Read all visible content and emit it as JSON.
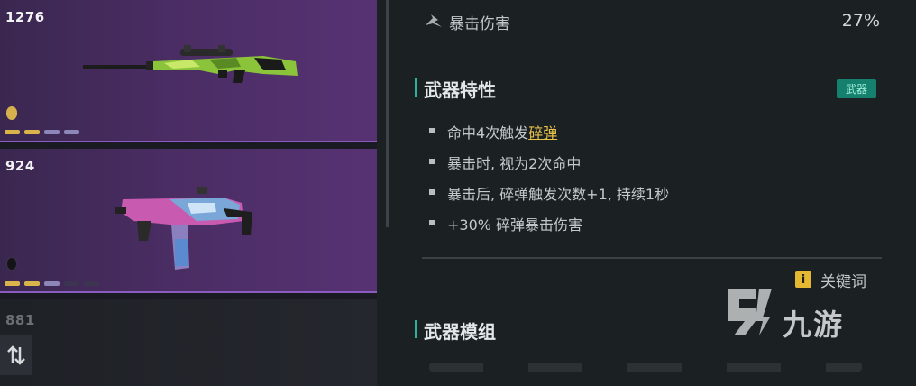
{
  "weapon_list": {
    "cards": [
      {
        "score": "1276",
        "rarity_color": "#d7b04d",
        "mod_colors": [
          "#d9b44a",
          "#d9b44a",
          "#8d86b8",
          "#8d86b8"
        ]
      },
      {
        "score": "924",
        "rarity_color": "#141418",
        "mod_colors": [
          "#d9b44a",
          "#d9b44a",
          "#8d86b8",
          "#3c3450",
          "#3c3450"
        ]
      },
      {
        "score": "881"
      }
    ],
    "sort_icon": "sort-icon"
  },
  "details": {
    "stat": {
      "icon": "crit-damage-icon",
      "label": "暴击伤害",
      "value": "27%"
    },
    "traits_section": {
      "title": "武器特性",
      "badge": "武器",
      "items": [
        {
          "text": "命中4次触发",
          "keyword": "碎弹"
        },
        {
          "text": "暴击时, 视为2次命中"
        },
        {
          "text": "暴击后, 碎弹触发次数+1, 持续1秒"
        },
        {
          "text": "+30% 碎弹暴击伤害"
        }
      ]
    },
    "keyword_link": {
      "icon": "info-icon",
      "icon_glyph": "i",
      "label": "关键词"
    },
    "mods_section": {
      "title": "武器模组"
    }
  },
  "watermark": {
    "text": "九游",
    "logo": "jiuyou-logo-icon"
  },
  "colors": {
    "accent_teal": "#2bb29a",
    "keyword_gold": "#e8c24a",
    "card_purple": "#4a2d63"
  }
}
